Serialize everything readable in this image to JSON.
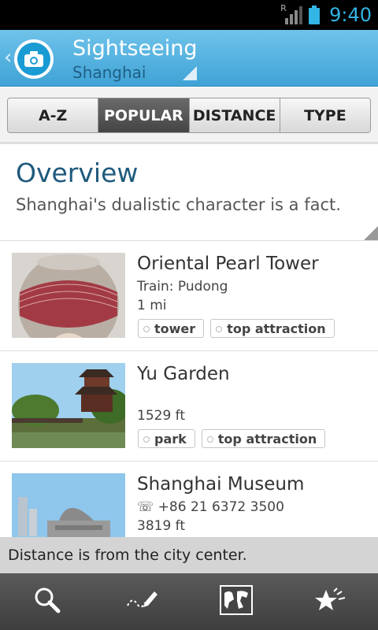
{
  "status_bar": {
    "clock": "9:40",
    "roaming_indicator": "R",
    "icons": [
      "signal-icon",
      "battery-icon"
    ],
    "accent_color": "#33b5e5"
  },
  "header": {
    "title": "Sightseeing",
    "subtitle": "Shanghai",
    "icon": "camera-icon",
    "gradient_top": "#6fc3ea",
    "gradient_bottom": "#3fa3d6"
  },
  "sort_tabs": [
    {
      "label": "A-Z",
      "active": false
    },
    {
      "label": "POPULAR",
      "active": true
    },
    {
      "label": "DISTANCE",
      "active": false
    },
    {
      "label": "TYPE",
      "active": false
    }
  ],
  "overview": {
    "title": "Overview",
    "text": "Shanghai's dualistic character is a fact."
  },
  "items": [
    {
      "title": "Oriental Pearl Tower",
      "subtitle": "Train: Pudong",
      "distance": "1 mi",
      "tags": [
        "tower",
        "top attraction"
      ]
    },
    {
      "title": "Yu Garden",
      "subtitle": "",
      "distance": "1529 ft",
      "tags": [
        "park",
        "top attraction"
      ]
    },
    {
      "title": "Shanghai Museum",
      "subtitle": "☏ +86 21 6372 3500",
      "distance": "3819 ft",
      "tags": []
    }
  ],
  "footer_note": "Distance is from the city center.",
  "bottom_bar": {
    "buttons": [
      "search-icon",
      "edit-icon",
      "map-icon",
      "favorites-icon"
    ]
  }
}
